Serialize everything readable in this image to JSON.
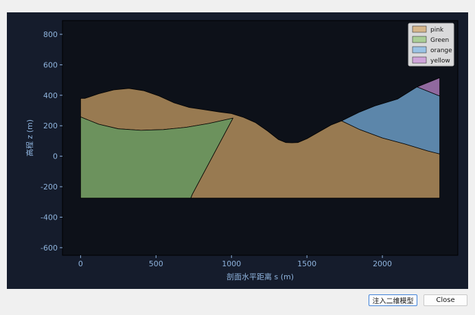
{
  "buttons": {
    "inject_label": "注入二维模型",
    "close_label": "Close"
  },
  "colors": {
    "figure_bg": "#151c2c",
    "axes_bg": "#0d1119",
    "axis_text": "#8fb4de",
    "legend_bg": "#e6e6e6"
  },
  "chart_data": {
    "type": "area",
    "title": "",
    "xlabel": "剖面水平距离 s (m)",
    "ylabel": "高程 z (m)",
    "xlim": [
      -120,
      2500
    ],
    "ylim": [
      -650,
      890
    ],
    "xticks": [
      0,
      500,
      1000,
      1500,
      2000
    ],
    "yticks": [
      -600,
      -400,
      -200,
      0,
      200,
      400,
      600,
      800
    ],
    "grid": false,
    "legend_position": "top-right",
    "series": [
      {
        "name": "pink",
        "color": "#d4a66a",
        "polygon": [
          [
            0,
            380
          ],
          [
            30,
            380
          ],
          [
            120,
            410
          ],
          [
            220,
            435
          ],
          [
            320,
            445
          ],
          [
            420,
            430
          ],
          [
            520,
            395
          ],
          [
            620,
            350
          ],
          [
            720,
            320
          ],
          [
            820,
            305
          ],
          [
            920,
            290
          ],
          [
            1000,
            280
          ],
          [
            1080,
            255
          ],
          [
            1160,
            220
          ],
          [
            1240,
            165
          ],
          [
            1310,
            110
          ],
          [
            1360,
            90
          ],
          [
            1400,
            88
          ],
          [
            1440,
            90
          ],
          [
            1500,
            115
          ],
          [
            1580,
            160
          ],
          [
            1660,
            205
          ],
          [
            1730,
            232
          ],
          [
            1850,
            175
          ],
          [
            2000,
            120
          ],
          [
            2150,
            80
          ],
          [
            2300,
            35
          ],
          [
            2380,
            15
          ],
          [
            2380,
            -275
          ],
          [
            730,
            -275
          ],
          [
            740,
            -250
          ],
          [
            1010,
            250
          ],
          [
            850,
            215
          ],
          [
            700,
            190
          ],
          [
            550,
            175
          ],
          [
            400,
            170
          ],
          [
            250,
            180
          ],
          [
            120,
            210
          ],
          [
            0,
            258
          ]
        ]
      },
      {
        "name": "Green",
        "color": "#96c97a",
        "polygon": [
          [
            0,
            258
          ],
          [
            120,
            210
          ],
          [
            250,
            180
          ],
          [
            400,
            170
          ],
          [
            550,
            175
          ],
          [
            700,
            190
          ],
          [
            850,
            215
          ],
          [
            1010,
            250
          ],
          [
            740,
            -250
          ],
          [
            730,
            -275
          ],
          [
            0,
            -275
          ]
        ]
      },
      {
        "name": "orange",
        "color": "#7fb8e8",
        "polygon": [
          [
            1730,
            232
          ],
          [
            1850,
            290
          ],
          [
            1950,
            330
          ],
          [
            2100,
            375
          ],
          [
            2230,
            455
          ],
          [
            2380,
            395
          ],
          [
            2380,
            15
          ],
          [
            2300,
            35
          ],
          [
            2150,
            80
          ],
          [
            2000,
            120
          ],
          [
            1850,
            175
          ]
        ]
      },
      {
        "name": "yellow",
        "color": "#c98ed8",
        "polygon": [
          [
            2230,
            455
          ],
          [
            2380,
            515
          ],
          [
            2380,
            395
          ]
        ]
      }
    ]
  }
}
